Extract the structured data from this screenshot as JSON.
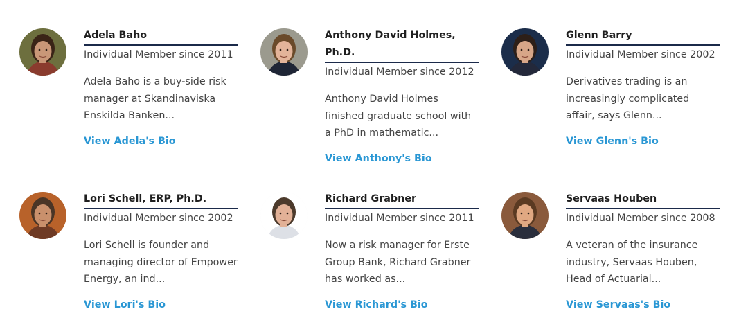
{
  "members": [
    {
      "name": "Adela Baho",
      "since": "Individual Member since 2011",
      "description": "Adela Baho is a buy-side risk manager at Skandinaviska Enskilda Banken...",
      "link": "View Adela's Bio",
      "avatar_icon": "profile-photo-adela",
      "colors": {
        "bg": "#6d6f3e",
        "hair": "#3a2417",
        "skin": "#c99778",
        "shirt": "#8a3b2e"
      }
    },
    {
      "name": "Anthony David Holmes, Ph.D.",
      "since": "Individual Member since 2012",
      "description": "Anthony David Holmes finished graduate school with a PhD in mathematic...",
      "link": "View Anthony's Bio",
      "avatar_icon": "profile-photo-anthony",
      "colors": {
        "bg": "#9b9a8e",
        "hair": "#6a4a2a",
        "skin": "#e3b49a",
        "shirt": "#1e2535"
      }
    },
    {
      "name": "Glenn Barry",
      "since": "Individual Member since 2002",
      "description": "Derivatives trading is an increasingly complicated affair, says Glenn...",
      "link": "View Glenn's Bio",
      "avatar_icon": "profile-photo-glenn",
      "colors": {
        "bg": "#1b2d4a",
        "hair": "#2d1f18",
        "skin": "#d7a688",
        "shirt": "#23283a"
      }
    },
    {
      "name": "Lori Schell, ERP, Ph.D.",
      "since": "Individual Member since 2002",
      "description": "Lori Schell is founder and managing director of Empower Energy, an ind...",
      "link": "View Lori's Bio",
      "avatar_icon": "profile-photo-lori",
      "colors": {
        "bg": "#b8622a",
        "hair": "#4a3526",
        "skin": "#c9906c",
        "shirt": "#6e3a24"
      }
    },
    {
      "name": "Richard Grabner",
      "since": "Individual Member since 2011",
      "description": "Now a risk manager for Erste Group Bank, Richard Grabner has worked as...",
      "link": "View Richard's Bio",
      "avatar_icon": "profile-photo-richard",
      "colors": {
        "bg": "#ffffff",
        "hair": "#4c3a2c",
        "skin": "#e2b197",
        "shirt": "#dde0e6"
      }
    },
    {
      "name": "Servaas Houben",
      "since": "Individual Member since 2008",
      "description": "A veteran of the insurance industry, Servaas Houben, Head of Actuarial...",
      "link": "View Servaas's Bio",
      "avatar_icon": "profile-photo-servaas",
      "colors": {
        "bg": "#8a5a3c",
        "hair": "#5a3a22",
        "skin": "#e0a882",
        "shirt": "#2a2e3c"
      }
    }
  ]
}
